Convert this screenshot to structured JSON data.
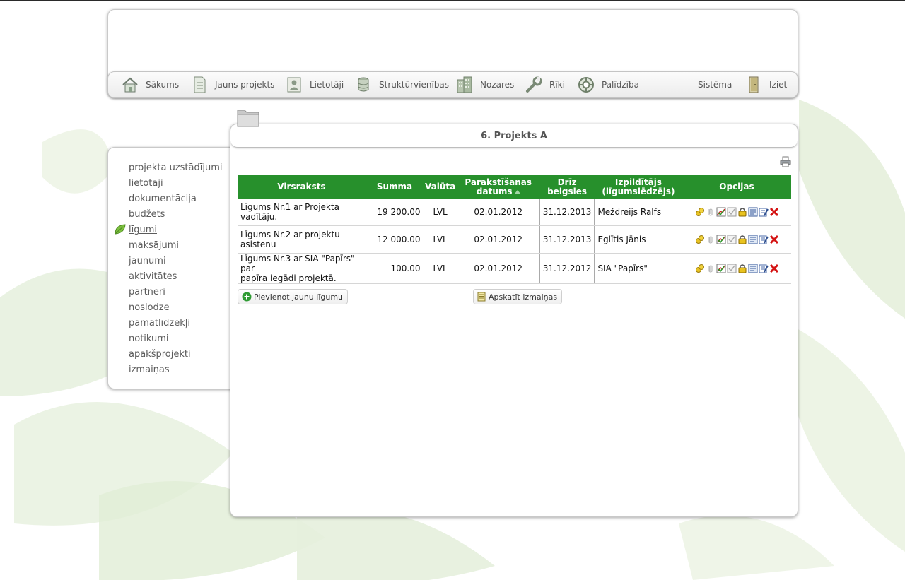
{
  "nav": {
    "home": "Sākums",
    "new_project": "Jauns projekts",
    "users": "Lietotāji",
    "units": "Struktūrvienības",
    "sectors": "Nozares",
    "tools": "Rīki",
    "help": "Palīdzība",
    "system": "Sistēma",
    "logout": "Iziet"
  },
  "sidebar": {
    "items": [
      {
        "label": "projekta uzstādījumi"
      },
      {
        "label": "lietotāji"
      },
      {
        "label": "dokumentācija"
      },
      {
        "label": "budžets"
      },
      {
        "label": "līgumi",
        "active": true
      },
      {
        "label": "maksājumi"
      },
      {
        "label": "jaunumi"
      },
      {
        "label": "aktivitātes"
      },
      {
        "label": "partneri"
      },
      {
        "label": "noslodze"
      },
      {
        "label": "pamatlīdzekļi"
      },
      {
        "label": "notikumi"
      },
      {
        "label": "apakšprojekti"
      },
      {
        "label": "izmaiņas"
      }
    ]
  },
  "main": {
    "title": "6. Projekts A",
    "columns": {
      "title": "Virsraksts",
      "sum": "Summa",
      "currency": "Valūta",
      "signed_1": "Parakstīšanas",
      "signed_2": "datums",
      "soon_1": "Drīz",
      "soon_2": "beigsies",
      "contractor_1": "Izpildītājs",
      "contractor_2": "(līgumslēdzējs)",
      "options": "Opcijas"
    },
    "rows": [
      {
        "title_1": "Līgums Nr.1 ar Projekta",
        "title_2": "vadītāju.",
        "sum": "19 200.00",
        "currency": "LVL",
        "signed": "02.01.2012",
        "end": "31.12.2013",
        "contractor": "Meždreijs Ralfs"
      },
      {
        "title_1": "Līgums Nr.2 ar projektu",
        "title_2": "asistenu",
        "sum": "12 000.00",
        "currency": "LVL",
        "signed": "02.01.2012",
        "end": "31.12.2013",
        "contractor": "Eglītis Jānis"
      },
      {
        "title_1": "Līgums Nr.3 ar SIA \"Papīrs\" par",
        "title_2": "papīra iegādi projektā.",
        "sum": "100.00",
        "currency": "LVL",
        "signed": "02.01.2012",
        "end": "31.12.2012",
        "contractor": "SIA \"Papīrs\""
      }
    ],
    "add_button": "Pievienot jaunu līgumu",
    "changes_button": "Apskatīt izmaiņas"
  }
}
